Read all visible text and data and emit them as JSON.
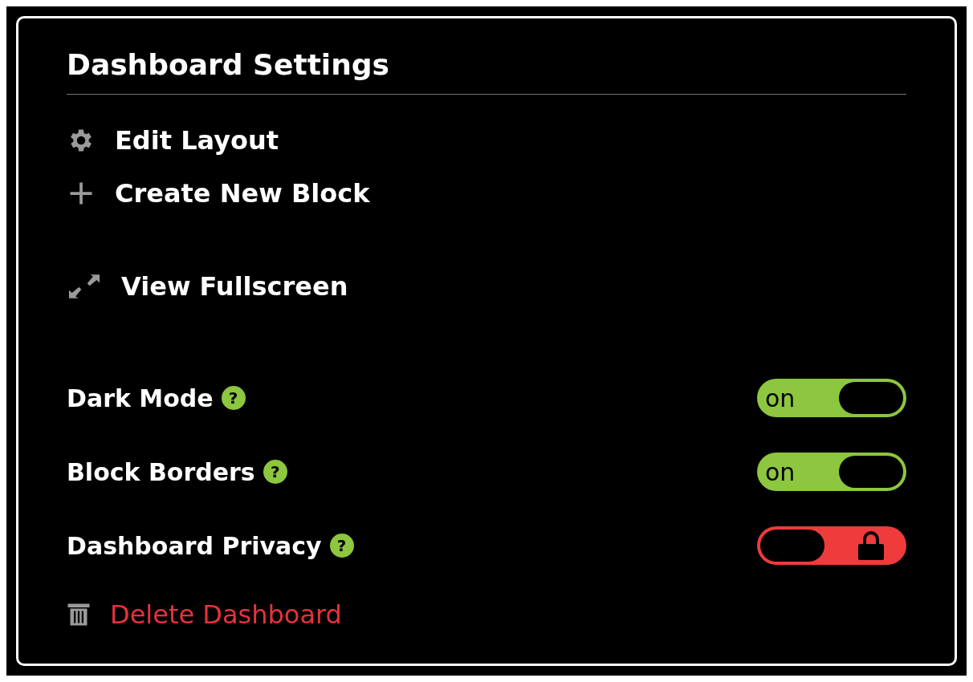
{
  "panel": {
    "title": "Dashboard Settings"
  },
  "actions": [
    {
      "kind": "gear",
      "label": "Edit Layout"
    },
    {
      "kind": "plus",
      "label": "Create New Block"
    },
    {
      "kind": "expand",
      "label": "View Fullscreen"
    }
  ],
  "toggles": [
    {
      "label": "Dark Mode",
      "help": "?",
      "on": true,
      "state_text": "on"
    },
    {
      "label": "Block Borders",
      "help": "?",
      "on": true,
      "state_text": "on"
    },
    {
      "label": "Dashboard Privacy",
      "help": "?",
      "on": false
    }
  ],
  "delete_action": {
    "label": "Delete Dashboard"
  }
}
